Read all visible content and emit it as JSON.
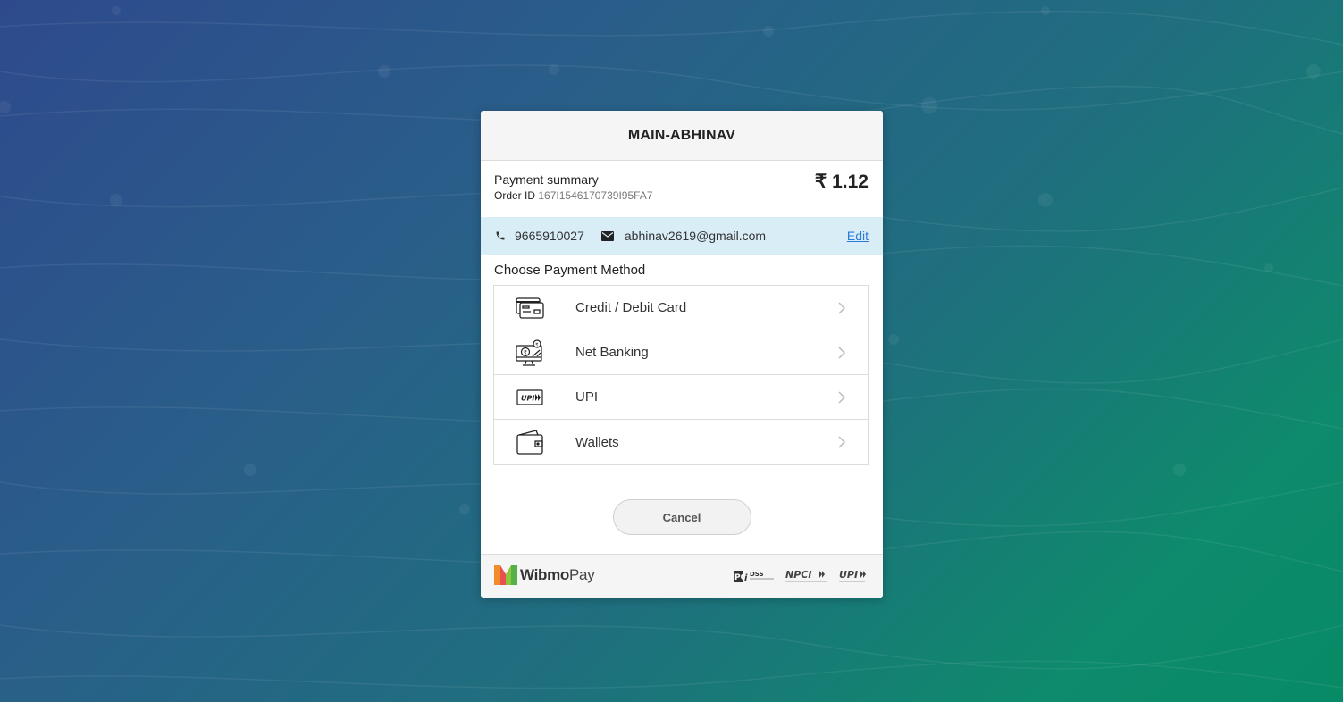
{
  "merchant": {
    "title": "MAIN-ABHINAV"
  },
  "summary": {
    "label": "Payment summary",
    "order_label": "Order ID",
    "order_id": "167I1546170739I95FA7",
    "amount": "₹ 1.12"
  },
  "contact": {
    "phone": "9665910027",
    "email": "abhinav2619@gmail.com",
    "edit_label": "Edit"
  },
  "methods": {
    "heading": "Choose Payment Method",
    "items": [
      {
        "label": "Credit / Debit Card",
        "icon": "credit-card-icon"
      },
      {
        "label": "Net Banking",
        "icon": "net-banking-icon"
      },
      {
        "label": "UPI",
        "icon": "upi-icon"
      },
      {
        "label": "Wallets",
        "icon": "wallet-icon"
      }
    ]
  },
  "actions": {
    "cancel_label": "Cancel"
  },
  "footer": {
    "brand_bold": "Wibmo",
    "brand_light": "Pay",
    "badges": [
      "PCI DSS",
      "NPCI",
      "UPI"
    ]
  },
  "colors": {
    "contact_bg": "#d9edf7",
    "link": "#2a7ad5",
    "header_bg": "#f5f5f5"
  }
}
